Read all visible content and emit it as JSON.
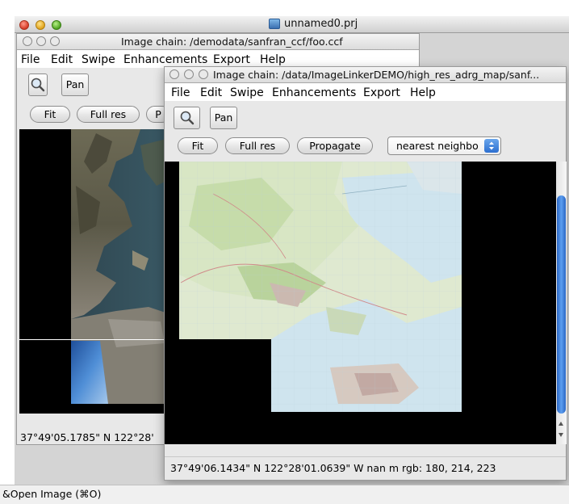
{
  "project_window": {
    "title": "unnamed0.prj",
    "icon": "project-file-icon"
  },
  "window1": {
    "title": "Image chain: /demodata/sanfran_ccf/foo.ccf",
    "menu": [
      "File",
      "Edit",
      "Swipe",
      "Enhancements",
      "Export",
      "Help"
    ],
    "tools": {
      "zoom_icon": "magnifier-icon",
      "pan_label": "Pan"
    },
    "buttons": {
      "fit": "Fit",
      "full_res": "Full res",
      "partial": "P"
    },
    "status": "37°49'05.1785\" N 122°28'"
  },
  "window2": {
    "title": "Image chain: /data/ImageLinkerDEMO/high_res_adrg_map/sanf...",
    "menu": [
      "File",
      "Edit",
      "Swipe",
      "Enhancements",
      "Export",
      "Help"
    ],
    "tools": {
      "zoom_icon": "magnifier-icon",
      "pan_label": "Pan"
    },
    "buttons": {
      "fit": "Fit",
      "full_res": "Full res",
      "propagate": "Propagate"
    },
    "resampler": {
      "selected": "nearest neighbo",
      "icon": "up-down-arrows-icon"
    },
    "status": "37°49'06.1434\" N 122°28'01.0639\" W  nan m  rgb: 180, 214, 223"
  },
  "status_bar": {
    "text": "&Open Image (⌘O)"
  },
  "colors": {
    "window_bg": "#e8e8e8",
    "canvas_bg": "#000000",
    "scrollbar_thumb": "#3b7fd6",
    "map_water": "#cfe4ee",
    "map_land": "#dfe9d0"
  }
}
